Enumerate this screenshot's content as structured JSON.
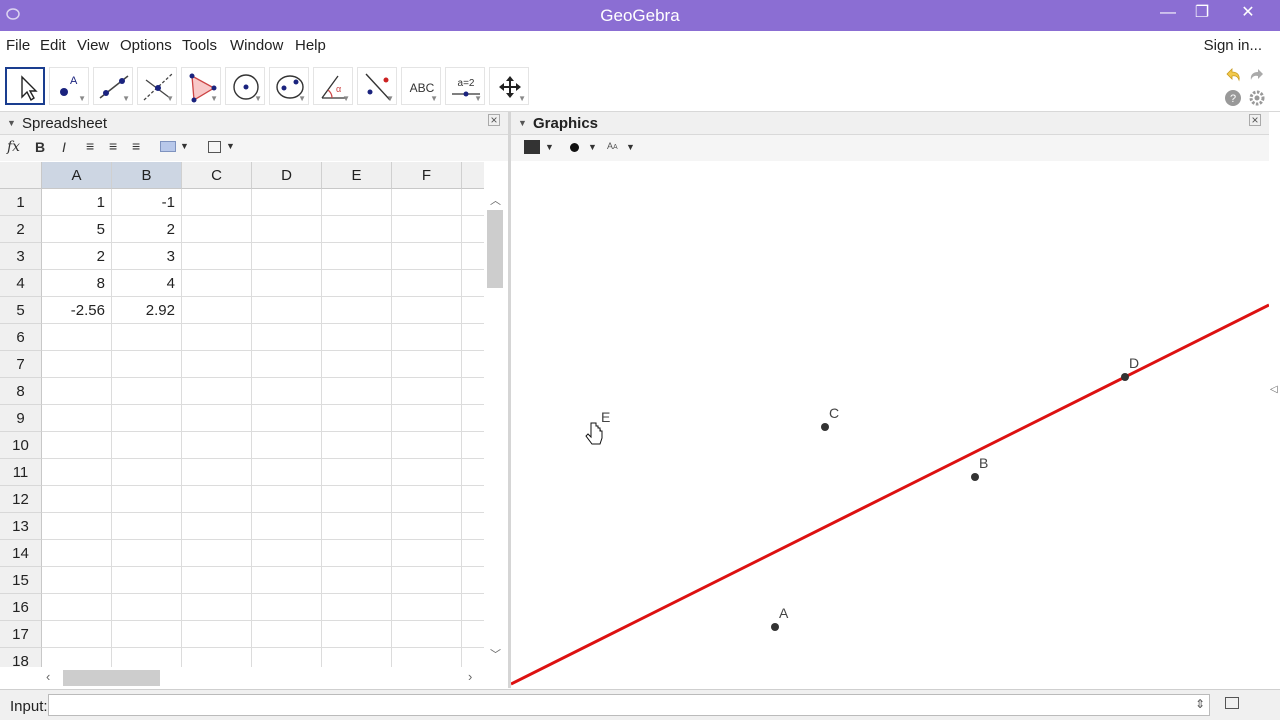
{
  "window": {
    "title": "GeoGebra",
    "minimize": "—",
    "maximize": "❐",
    "close": "✕"
  },
  "menu": {
    "items": [
      "File",
      "Edit",
      "View",
      "Options",
      "Tools",
      "Window",
      "Help"
    ],
    "sign_in": "Sign in..."
  },
  "toolbar": {
    "tools": [
      "move-tool",
      "point-tool",
      "line-tool",
      "perpendicular-tool",
      "polygon-tool",
      "circle-tool",
      "conic-tool",
      "angle-tool",
      "reflect-tool",
      "text-tool",
      "slider-tool",
      "move-graphics-tool"
    ],
    "text_tool_label": "ABC",
    "slider_tool_label": "a=2"
  },
  "spreadsheet": {
    "title": "Spreadsheet",
    "stylebar": {
      "fx": "fx",
      "bold": "B",
      "italic": "I"
    },
    "columns": [
      "A",
      "B",
      "C",
      "D",
      "E",
      "F"
    ],
    "rows": [
      "1",
      "2",
      "3",
      "4",
      "5",
      "6",
      "7",
      "8",
      "9",
      "10",
      "11",
      "12",
      "13",
      "14",
      "15",
      "16",
      "17",
      "18"
    ],
    "cells": [
      [
        "1",
        "-1"
      ],
      [
        "5",
        "2"
      ],
      [
        "2",
        "3"
      ],
      [
        "8",
        "4"
      ],
      [
        "-2.56",
        "2.92"
      ]
    ]
  },
  "graphics": {
    "title": "Graphics",
    "points": [
      {
        "label": "A",
        "x": 1,
        "y": -1
      },
      {
        "label": "B",
        "x": 5,
        "y": 2
      },
      {
        "label": "C",
        "x": 2,
        "y": 3
      },
      {
        "label": "D",
        "x": 8,
        "y": 4
      },
      {
        "label": "E",
        "x": -2.56,
        "y": 2.92
      }
    ],
    "line_color": "#dd1111",
    "point_color": "#333333"
  },
  "input_bar": {
    "label": "Input:",
    "value": ""
  }
}
